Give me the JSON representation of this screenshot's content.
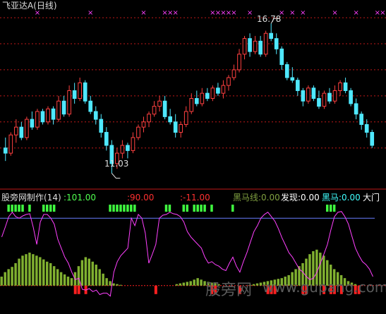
{
  "chart_data": [
    {
      "type": "candlestick",
      "title": "飞亚达A",
      "period": "(日线)",
      "colors": {
        "up": "#ff4040",
        "down": "#4fe8ff",
        "marker": "#ff40ff",
        "grid": "#c01818",
        "annotation": "#dddddd"
      },
      "annotations": {
        "high": "16.78",
        "low": "11.03"
      },
      "ylim": [
        10.8,
        17.3
      ],
      "candles": [
        [
          12.0,
          12.4,
          11.5,
          11.8
        ],
        [
          11.8,
          12.6,
          11.7,
          12.5
        ],
        [
          12.5,
          13.1,
          12.2,
          12.8
        ],
        [
          12.8,
          13.0,
          12.3,
          12.4
        ],
        [
          12.4,
          13.2,
          12.3,
          13.1
        ],
        [
          13.1,
          13.4,
          12.7,
          12.8
        ],
        [
          12.8,
          13.5,
          12.7,
          13.4
        ],
        [
          13.4,
          13.5,
          12.9,
          13.0
        ],
        [
          13.0,
          13.6,
          12.9,
          13.5
        ],
        [
          13.5,
          13.6,
          12.9,
          13.1
        ],
        [
          13.1,
          14.0,
          13.0,
          13.8
        ],
        [
          13.8,
          14.0,
          13.2,
          13.3
        ],
        [
          13.3,
          14.4,
          13.2,
          14.2
        ],
        [
          14.2,
          14.5,
          13.7,
          13.9
        ],
        [
          13.9,
          14.7,
          13.8,
          14.5
        ],
        [
          14.5,
          14.6,
          13.7,
          13.8
        ],
        [
          13.8,
          14.0,
          13.3,
          13.4
        ],
        [
          13.4,
          13.6,
          12.9,
          13.1
        ],
        [
          13.1,
          13.3,
          12.4,
          12.6
        ],
        [
          12.6,
          12.8,
          11.9,
          12.1
        ],
        [
          12.1,
          12.3,
          11.03,
          11.4
        ],
        [
          11.4,
          12.0,
          11.2,
          11.8
        ],
        [
          11.8,
          12.3,
          11.6,
          12.1
        ],
        [
          12.1,
          12.2,
          11.6,
          11.9
        ],
        [
          11.9,
          12.6,
          11.8,
          12.4
        ],
        [
          12.4,
          12.9,
          12.3,
          12.8
        ],
        [
          12.8,
          13.2,
          12.6,
          13.0
        ],
        [
          13.0,
          13.4,
          12.8,
          13.3
        ],
        [
          13.3,
          13.8,
          13.2,
          13.6
        ],
        [
          13.6,
          14.0,
          13.4,
          13.8
        ],
        [
          13.8,
          14.0,
          13.1,
          13.2
        ],
        [
          13.2,
          13.5,
          12.9,
          13.0
        ],
        [
          13.0,
          13.3,
          12.4,
          12.6
        ],
        [
          12.6,
          13.0,
          12.4,
          12.9
        ],
        [
          12.9,
          13.6,
          12.8,
          13.4
        ],
        [
          13.4,
          14.1,
          13.3,
          13.9
        ],
        [
          13.9,
          14.2,
          13.6,
          13.7
        ],
        [
          13.7,
          14.3,
          13.6,
          14.1
        ],
        [
          14.1,
          14.3,
          13.8,
          13.9
        ],
        [
          13.9,
          14.4,
          13.8,
          14.3
        ],
        [
          14.3,
          14.5,
          14.0,
          14.1
        ],
        [
          14.1,
          14.6,
          13.9,
          14.4
        ],
        [
          14.4,
          14.8,
          14.2,
          14.7
        ],
        [
          14.7,
          15.2,
          14.6,
          15.0
        ],
        [
          15.0,
          15.8,
          14.9,
          15.6
        ],
        [
          15.6,
          16.3,
          15.4,
          16.2
        ],
        [
          16.2,
          16.4,
          15.5,
          15.7
        ],
        [
          15.7,
          16.3,
          15.6,
          16.1
        ],
        [
          16.1,
          16.3,
          15.5,
          15.6
        ],
        [
          15.6,
          16.5,
          15.5,
          16.4
        ],
        [
          16.4,
          16.78,
          16.1,
          16.2
        ],
        [
          16.2,
          16.4,
          15.6,
          15.8
        ],
        [
          15.8,
          15.9,
          15.0,
          15.2
        ],
        [
          15.2,
          15.3,
          14.6,
          14.7
        ],
        [
          14.7,
          15.1,
          14.5,
          14.6
        ],
        [
          14.6,
          14.7,
          14.0,
          14.2
        ],
        [
          14.2,
          14.3,
          13.6,
          13.8
        ],
        [
          13.8,
          14.4,
          13.7,
          14.3
        ],
        [
          14.3,
          14.4,
          13.8,
          13.9
        ],
        [
          13.9,
          14.2,
          13.5,
          13.6
        ],
        [
          13.6,
          14.2,
          13.5,
          14.1
        ],
        [
          14.1,
          14.3,
          13.7,
          13.8
        ],
        [
          13.8,
          14.4,
          13.7,
          14.2
        ],
        [
          14.2,
          14.6,
          14.0,
          14.5
        ],
        [
          14.5,
          14.7,
          14.1,
          14.2
        ],
        [
          14.2,
          14.3,
          13.6,
          13.7
        ],
        [
          13.7,
          13.9,
          13.1,
          13.3
        ],
        [
          13.3,
          13.4,
          12.7,
          12.9
        ],
        [
          12.9,
          13.1,
          12.4,
          12.6
        ],
        [
          12.6,
          12.7,
          12.0,
          12.1
        ]
      ],
      "markers_x_index": [
        6,
        16,
        26,
        30,
        31,
        32,
        39,
        40,
        41,
        42,
        43,
        46,
        52,
        54,
        56,
        62,
        66,
        70,
        71,
        72,
        73
      ],
      "grid_levels": [
        17.0,
        16.0,
        15.0,
        14.0,
        13.0,
        12.0
      ]
    },
    {
      "type": "indicator",
      "name": "股旁网制作(14)",
      "values": [
        {
          "label": ":101.00",
          "color": "#50ff50"
        },
        {
          "label": ":90.00",
          "color": "#ff3030"
        },
        {
          "label": ":-11.00",
          "color": "#ff3030"
        },
        {
          "label": "黑马线:0.00",
          "color": "#80a040"
        },
        {
          "label": "发现:0.00",
          "color": "#ffffff"
        },
        {
          "label": "黑马:0.00",
          "color": "#40ffff"
        },
        {
          "label": "大门",
          "color": "#ffffff"
        }
      ],
      "ylim": [
        -20,
        110
      ],
      "reference_line": 90,
      "colors": {
        "line": "#ff40ff",
        "bars": "#80b030",
        "signal": "#40ff40",
        "negative": "#ff2020",
        "ref": "#6a7dff",
        "baseline": "#ff2020"
      },
      "line": [
        65,
        78,
        92,
        98,
        92,
        90,
        93,
        95,
        96,
        78,
        55,
        85,
        95,
        95,
        90,
        82,
        62,
        50,
        38,
        30,
        18,
        8,
        10,
        -5,
        -6,
        -4,
        -8,
        -6,
        -12,
        -10,
        -10,
        -14,
        18,
        32,
        40,
        45,
        50,
        90,
        80,
        95,
        90,
        70,
        30,
        42,
        55,
        90,
        94,
        95,
        98,
        96,
        95,
        92,
        85,
        72,
        65,
        60,
        55,
        50,
        38,
        30,
        32,
        28,
        26,
        22,
        20,
        30,
        38,
        26,
        18,
        32,
        44,
        58,
        72,
        80,
        90,
        95,
        98,
        92,
        86,
        76,
        64,
        54,
        44,
        38,
        30,
        22,
        18,
        12,
        8,
        10,
        18,
        30,
        42,
        55,
        75,
        92,
        98,
        99,
        92,
        82,
        66,
        50,
        40,
        32,
        28,
        22,
        12
      ],
      "bars": [
        12,
        18,
        22,
        25,
        30,
        36,
        40,
        42,
        44,
        42,
        40,
        38,
        35,
        32,
        30,
        26,
        22,
        18,
        15,
        12,
        10,
        18,
        26,
        34,
        38,
        36,
        32,
        28,
        22,
        16,
        10,
        6,
        3,
        2,
        1,
        0,
        0,
        0,
        0,
        0,
        0,
        0,
        0,
        0,
        0,
        0,
        0,
        0,
        0,
        0,
        2,
        3,
        4,
        5,
        6,
        8,
        10,
        8,
        6,
        5,
        4,
        3,
        2,
        0,
        0,
        0,
        0,
        0,
        0,
        0,
        0,
        1,
        2,
        3,
        4,
        5,
        6,
        7,
        8,
        9,
        10,
        12,
        14,
        18,
        22,
        26,
        30,
        36,
        42,
        46,
        48,
        44,
        40,
        34,
        28,
        22,
        18,
        14,
        10,
        6,
        4,
        2,
        0,
        0,
        0
      ],
      "signals": [
        2,
        3,
        4,
        5,
        6,
        8,
        12,
        13,
        14,
        15,
        31,
        32,
        33,
        34,
        35,
        36,
        37,
        38,
        47,
        48,
        52,
        53,
        55,
        56,
        57,
        58,
        60,
        66,
        93,
        94,
        95
      ],
      "negatives": [
        21,
        22,
        24,
        44,
        60,
        61,
        68,
        76,
        77,
        78,
        86,
        87,
        92,
        94,
        95,
        97,
        101,
        102
      ]
    }
  ],
  "watermark": {
    "brand": "股旁网",
    "url": "www.gupang.com"
  }
}
